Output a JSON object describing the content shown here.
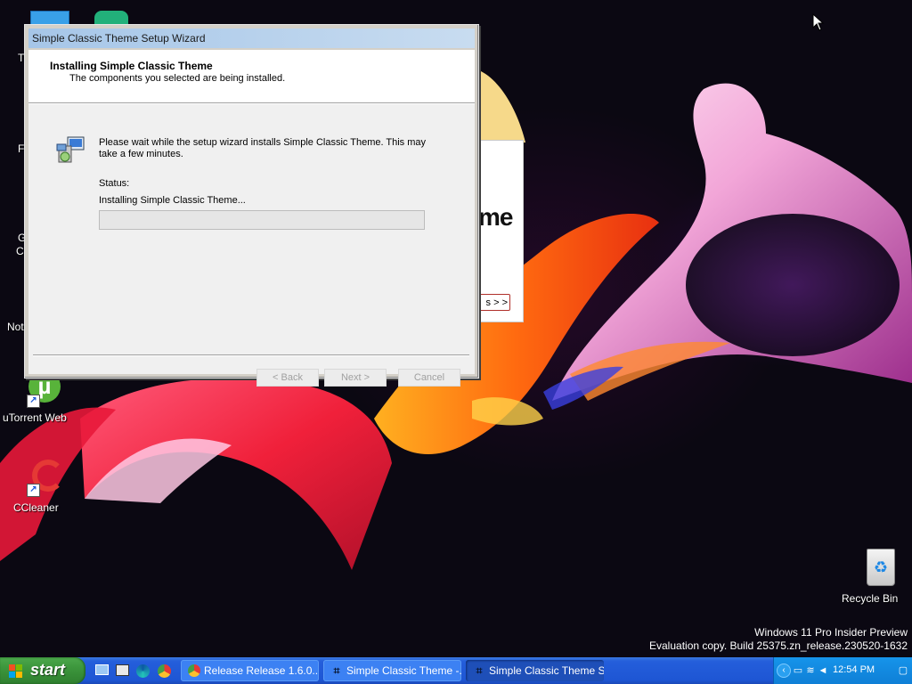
{
  "desktop": {
    "icons": {
      "top1": "T",
      "firefox": "F",
      "chrome": "G",
      "chrome2": "C",
      "notepad": "Not",
      "utorrent": "uTorrent Web",
      "ccleaner": "CCleaner",
      "recycle": "Recycle Bin"
    },
    "watermark": {
      "line1": "Windows 11 Pro Insider Preview",
      "line2": "Evaluation copy. Build 25375.zn_release.230520-1632"
    }
  },
  "background_window": {
    "big_text": "me",
    "button_label": "s > >"
  },
  "wizard": {
    "title": "Simple Classic Theme Setup Wizard",
    "header_title": "Installing Simple Classic Theme",
    "header_subtitle": "The components you selected are being installed.",
    "message": "Please wait while the setup wizard installs Simple Classic Theme. This may take a few minutes.",
    "status_label": "Status:",
    "status_text": "Installing Simple Classic Theme...",
    "progress": 0,
    "buttons": {
      "back": "< Back",
      "next": "Next >",
      "cancel": "Cancel"
    }
  },
  "taskbar": {
    "start_label": "start",
    "quick_launch": [
      "show-desktop-icon",
      "explorer-icon",
      "edge-icon",
      "chrome-icon"
    ],
    "tasks": [
      {
        "label": "Release Release 1.6.0...",
        "icon": "chrome-icon"
      },
      {
        "label": "Simple Classic Theme -...",
        "icon": "setup-icon"
      },
      {
        "label": "Simple Classic Theme S...",
        "icon": "setup-icon"
      }
    ],
    "clock": "12:54 PM"
  },
  "colors": {
    "taskbar_blue": "#245edb",
    "start_green": "#3c963c",
    "tray_blue": "#1694ea",
    "titlebar": "#a6c6e8"
  }
}
